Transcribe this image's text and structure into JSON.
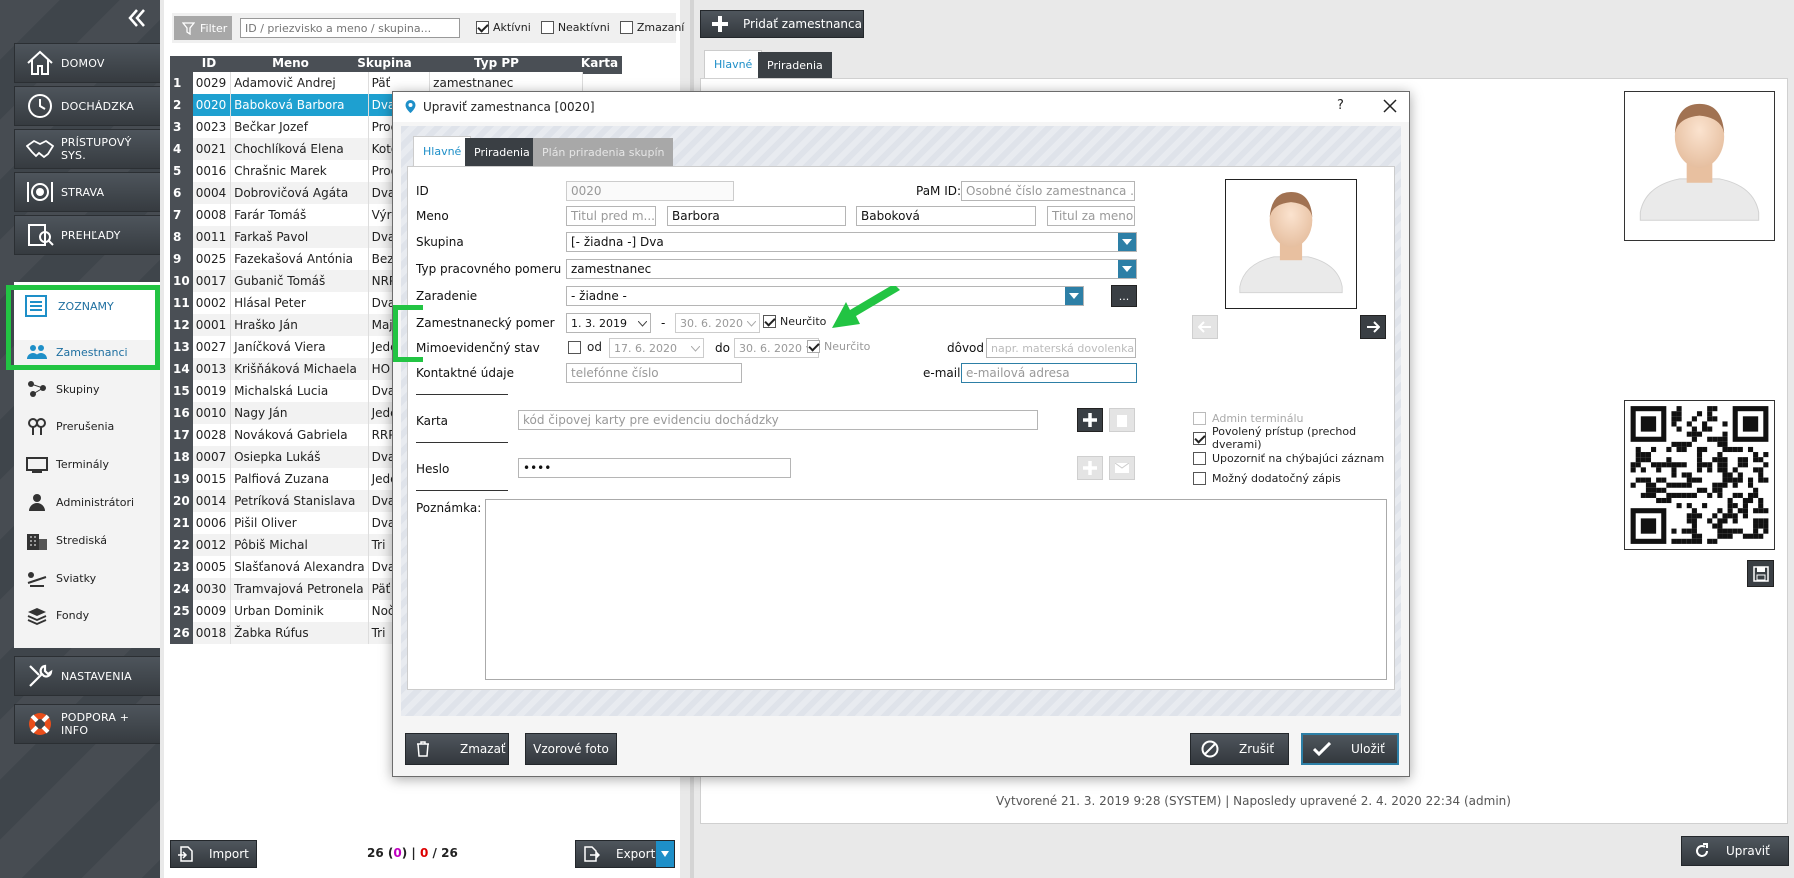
{
  "sidebar": {
    "nav_top": [
      {
        "label": "DOMOV",
        "icon": "home-icon"
      },
      {
        "label": "DOCHÁDZKA",
        "icon": "clock-icon"
      },
      {
        "label": "PRÍSTUPOVÝ SYS.",
        "icon": "handshake-icon"
      },
      {
        "label": "STRAVA",
        "icon": "plate-icon"
      },
      {
        "label": "PREHĽADY",
        "icon": "report-icon"
      }
    ],
    "section": {
      "label": "ZOZNAMY",
      "icon": "list-icon"
    },
    "subitems": [
      {
        "label": "Zamestnanci",
        "icon": "people-icon"
      },
      {
        "label": "Skupiny",
        "icon": "group-icon"
      },
      {
        "label": "Prerušenia",
        "icon": "pin-icon"
      },
      {
        "label": "Terminály",
        "icon": "terminal-icon"
      },
      {
        "label": "Administrátori",
        "icon": "admin-icon"
      },
      {
        "label": "Strediská",
        "icon": "building-icon"
      },
      {
        "label": "Sviatky",
        "icon": "holiday-icon"
      },
      {
        "label": "Fondy",
        "icon": "layers-icon"
      }
    ],
    "nav_bottom": [
      {
        "label": "NASTAVENIA",
        "icon": "tools-icon"
      },
      {
        "label": "PODPORA + INFO",
        "icon": "lifebuoy-icon"
      }
    ]
  },
  "list": {
    "filter_label": "Filter",
    "search_placeholder": "ID / priezvisko a meno / skupina...",
    "checks": [
      {
        "label": "Aktívni",
        "checked": true
      },
      {
        "label": "Neaktívni",
        "checked": false
      },
      {
        "label": "Zmazaní",
        "checked": false
      }
    ],
    "columns": [
      "ID",
      "Meno",
      "Skupina",
      "Typ PP",
      "Karta"
    ],
    "rows": [
      [
        "1",
        "0029",
        "Adamovič Andrej",
        "Päť",
        "zamestnanec"
      ],
      [
        "2",
        "0020",
        "Baboková Barbora",
        "Dva",
        ""
      ],
      [
        "3",
        "0023",
        "Bečkar Jozef",
        "Produ",
        ""
      ],
      [
        "4",
        "0021",
        "Chochlíková Elena",
        "Kotolň",
        ""
      ],
      [
        "5",
        "0016",
        "Chrašnic Marek",
        "Produ",
        ""
      ],
      [
        "6",
        "0004",
        "Dobrovičová Agáta",
        "Dva",
        ""
      ],
      [
        "7",
        "0008",
        "Farár Tomáš",
        "Výroba",
        ""
      ],
      [
        "8",
        "0011",
        "Farkaš Pavol",
        "Dva",
        ""
      ],
      [
        "9",
        "0025",
        "Fazekašová Antónia",
        "Bez zm",
        ""
      ],
      [
        "10",
        "0017",
        "Gubanič Tomáš",
        "NRPČ",
        ""
      ],
      [
        "11",
        "0002",
        "Hlásal Peter",
        "Dva",
        ""
      ],
      [
        "12",
        "0001",
        "Hraško Ján",
        "Majstr",
        ""
      ],
      [
        "13",
        "0027",
        "Janíčková Viera",
        "Jeden",
        ""
      ],
      [
        "14",
        "0013",
        "Krišňáková Michaela",
        "HO",
        ""
      ],
      [
        "15",
        "0019",
        "Michalská Lucia",
        "Dva",
        ""
      ],
      [
        "16",
        "0010",
        "Nagy Ján",
        "Jeden",
        ""
      ],
      [
        "17",
        "0028",
        "Nováková Gabriela",
        "RRPČ",
        ""
      ],
      [
        "18",
        "0007",
        "Osiepka Lukáš",
        "Dva",
        ""
      ],
      [
        "19",
        "0015",
        "Palfiová Zuzana",
        "Jeden",
        ""
      ],
      [
        "20",
        "0014",
        "Petríková Stanislava",
        "Dva",
        ""
      ],
      [
        "21",
        "0006",
        "Pišil Oliver",
        "Dva",
        ""
      ],
      [
        "22",
        "0012",
        "Pôbiš Michal",
        "Tri",
        ""
      ],
      [
        "23",
        "0005",
        "Slašťanová Alexandra",
        "Dva",
        ""
      ],
      [
        "24",
        "0030",
        "Tramvajová Petronela",
        "Päť",
        ""
      ],
      [
        "25",
        "0009",
        "Urban Dominik",
        "Nočná",
        ""
      ],
      [
        "26",
        "0018",
        "Žabka Rúfus",
        "Tri",
        ""
      ]
    ],
    "selected_row": 2,
    "import_label": "Import",
    "export_label": "Export",
    "count_total": "26",
    "count_open": "(",
    "count_deleted": "0",
    "count_close": ")",
    "count_sep": "|",
    "count_red": "0",
    "count_slash": "/",
    "count_all": "26"
  },
  "right": {
    "add_label": "Pridať zamestnanca",
    "tabs": [
      "Hlavné",
      "Priradenia"
    ],
    "footer_text": "Vytvorené 21. 3. 2019 9:28 (SYSTEM) | Naposledy upravené 2. 4. 2020 22:34 (admin)",
    "edit_label": "Upraviť"
  },
  "dialog": {
    "title": "Upraviť zamestnanca [0020]",
    "help": "?",
    "tabs": [
      "Hlavné",
      "Priradenia",
      "Plán priradenia skupín"
    ],
    "labels": {
      "id": "ID",
      "pam": "PaM ID:",
      "meno": "Meno",
      "skupina": "Skupina",
      "typ": "Typ pracovného pomeru",
      "zaradenie": "Zaradenie",
      "pomer": "Zamestnanecký pomer",
      "mimo": "Mimoevidenčný stav",
      "kontakt": "Kontaktné údaje",
      "email": "e-mail",
      "karta": "Karta",
      "heslo": "Heslo",
      "poznamka": "Poznámka:",
      "od": "od",
      "do": "do",
      "dovod": "dôvod",
      "dash": "-"
    },
    "values": {
      "id": "0020",
      "pam_placeholder": "Osobné číslo zamestnanca ...",
      "title_before_placeholder": "Titul pred m...",
      "first_name": "Barbora",
      "last_name": "Baboková",
      "title_after_placeholder": "Titul za menom",
      "skupina": "[- žiadna -] Dva",
      "typ": "zamestnanec",
      "zaradenie": "- žiadne -",
      "zaradenie_btn": "...",
      "pomer_from": "1. 3. 2019",
      "pomer_to": "30. 6. 2020",
      "neurcito": "Neurčito",
      "mimo_from": "17. 6. 2020",
      "mimo_to": "30. 6. 2020",
      "mimo_neurcito": "Neurčito",
      "dovod_placeholder": "napr. materská dovolenka",
      "phone_placeholder": "telefónne číslo",
      "email_placeholder": "e-mailová adresa",
      "card_placeholder": "kód čipovej karty pre evidenciu dochádzky",
      "password": "••••"
    },
    "options": [
      {
        "label": "Admin terminálu",
        "checked": false,
        "disabled": true
      },
      {
        "label": "Povolený prístup (prechod dverami)",
        "checked": true,
        "disabled": false
      },
      {
        "label": "Upozorniť na chýbajúci záznam",
        "checked": false,
        "disabled": false
      },
      {
        "label": "Možný dodatočný zápis",
        "checked": false,
        "disabled": false
      }
    ],
    "buttons": {
      "delete": "Zmazať",
      "sample_photo": "Vzorové foto",
      "cancel": "Zrušiť",
      "save": "Uložiť"
    }
  },
  "colors": {
    "highlight": "#22c443",
    "selection": "#1ea0d0",
    "accent": "#2d7fa6"
  }
}
